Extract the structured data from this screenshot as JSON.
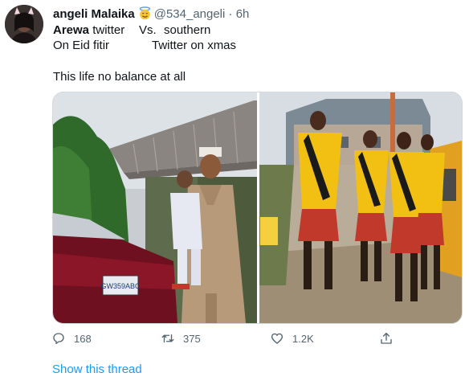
{
  "tweet": {
    "display_name": "angeli Malaika",
    "handle": "@534_angeli",
    "separator": "·",
    "time": "6h",
    "line1_col1_bold": "Arewa",
    "line1_col1_rest": " twitter",
    "line1_col2": "Vs.",
    "line1_col3": "southern",
    "line2_col1": "On Eid fitir",
    "line2_col3": "Twitter on xmas",
    "line3": "This life no balance at all",
    "media_left_plate": "GW359ABC"
  },
  "actions": {
    "replies": "168",
    "retweets": "375",
    "likes": "1.2K"
  },
  "footer": {
    "show_thread": "Show this thread"
  },
  "colors": {
    "accent": "#1d9bf0",
    "muted": "#536471",
    "text": "#0f1419"
  },
  "icons": [
    "smiling-face-with-halo-icon",
    "reply-icon",
    "retweet-icon",
    "like-icon",
    "share-icon"
  ]
}
